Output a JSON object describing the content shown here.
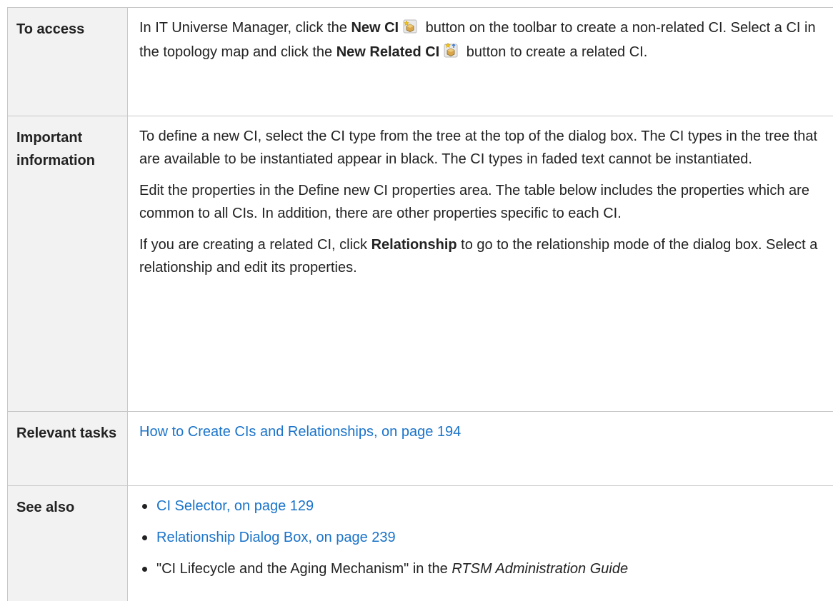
{
  "rows": {
    "access": {
      "label": "To access",
      "t1": "In IT Universe Manager, click the ",
      "new_ci": "New CI",
      "t2": " button on the toolbar to create a non-related CI. Select a CI in the topology map and click the ",
      "new_related_ci": "New Related CI",
      "t3": " button to create a related CI."
    },
    "important": {
      "label": "Important information",
      "p1": "To define a new CI, select the CI type from the tree at the top of the dialog box. The CI types in the tree that are available to be instantiated appear in black. The CI types in faded text cannot be instantiated.",
      "p2": "Edit the properties in the Define new CI properties area. The table below includes the properties which are common to all CIs. In addition, there are other properties specific to each CI.",
      "p3a": "If you are creating a related CI, click ",
      "p3_bold": "Relationship",
      "p3b": " to go to the relationship mode of the dialog box. Select a relationship and edit its properties."
    },
    "tasks": {
      "label": "Relevant tasks",
      "link": "How to Create CIs and Relationships, on page 194"
    },
    "see_also": {
      "label": "See also",
      "link1": "CI Selector, on page 129",
      "link2": "Relationship Dialog Box, on page 239",
      "item3a": "\"CI Lifecycle and the Aging Mechanism\" in the ",
      "item3_italic": "RTSM Administration Guide"
    }
  },
  "icons": {
    "new_ci": "new-ci-icon",
    "new_related_ci": "new-related-ci-icon"
  },
  "colors": {
    "link": "#1a73c9",
    "label_bg": "#f2f2f2",
    "border": "#c8c8c8"
  }
}
